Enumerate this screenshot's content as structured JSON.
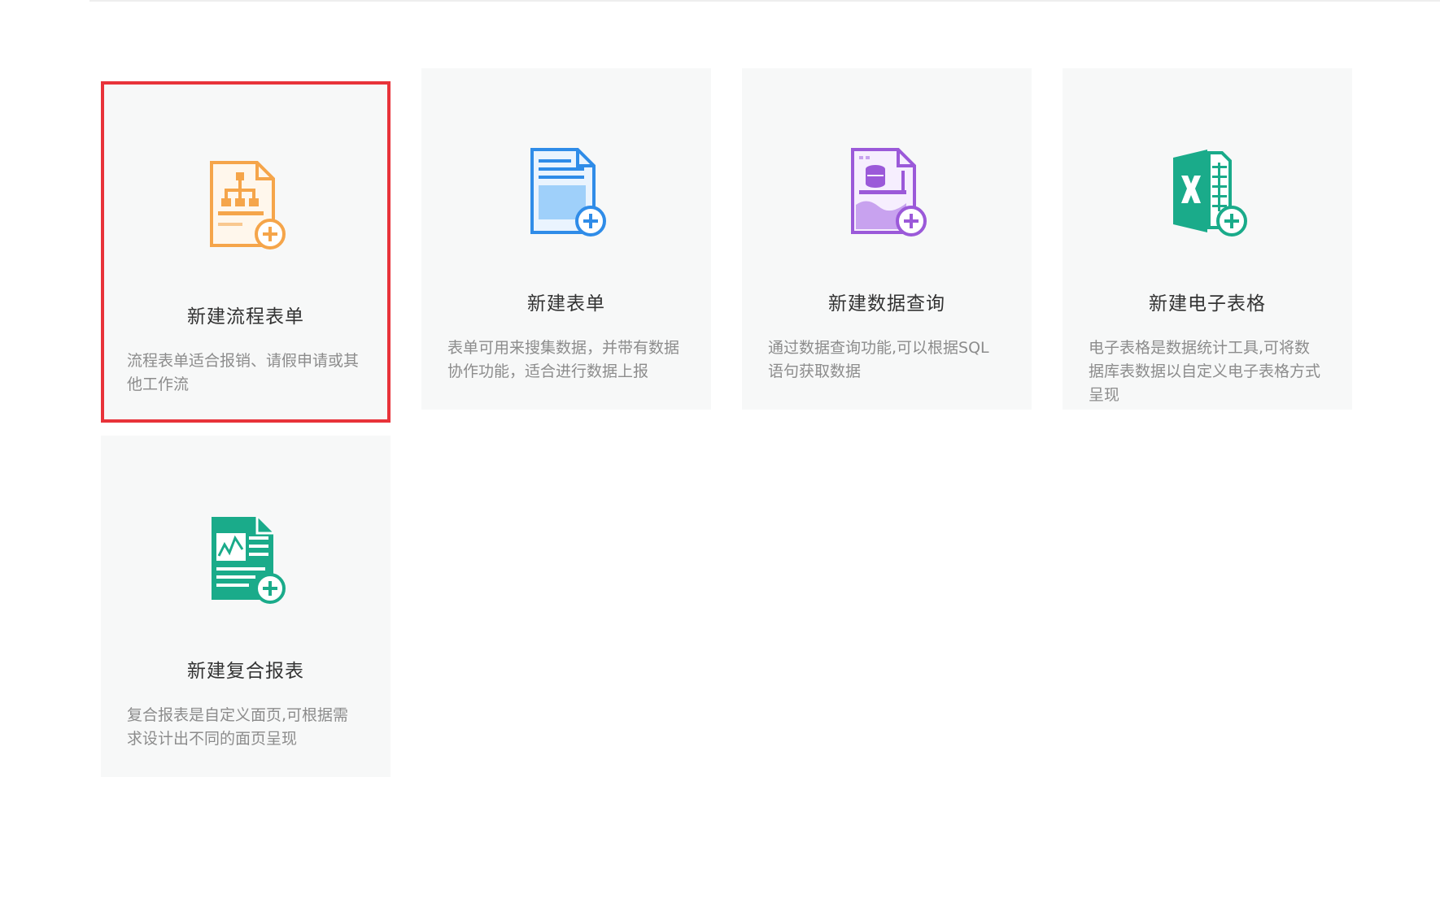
{
  "cards": [
    {
      "title": "新建流程表单",
      "desc": "流程表单适合报销、请假申请或其他工作流",
      "icon": "workflow-form-add-icon",
      "color": "#f5a54a",
      "selected": true
    },
    {
      "title": "新建表单",
      "desc": "表单可用来搜集数据，并带有数据协作功能，适合进行数据上报",
      "icon": "form-add-icon",
      "color": "#2f8ce8"
    },
    {
      "title": "新建数据查询",
      "desc": "通过数据查询功能,可以根据SQL语句获取数据",
      "icon": "data-query-add-icon",
      "color": "#9b59d9"
    },
    {
      "title": "新建电子表格",
      "desc": "电子表格是数据统计工具,可将数据库表数据以自定义电子表格方式呈现",
      "icon": "spreadsheet-add-icon",
      "color": "#1aab8a"
    },
    {
      "title": "新建复合报表",
      "desc": "复合报表是自定义面页,可根据需求设计出不同的面页呈现",
      "icon": "composite-report-add-icon",
      "color": "#1aab8a"
    }
  ],
  "highlight_color": "#e8333a"
}
